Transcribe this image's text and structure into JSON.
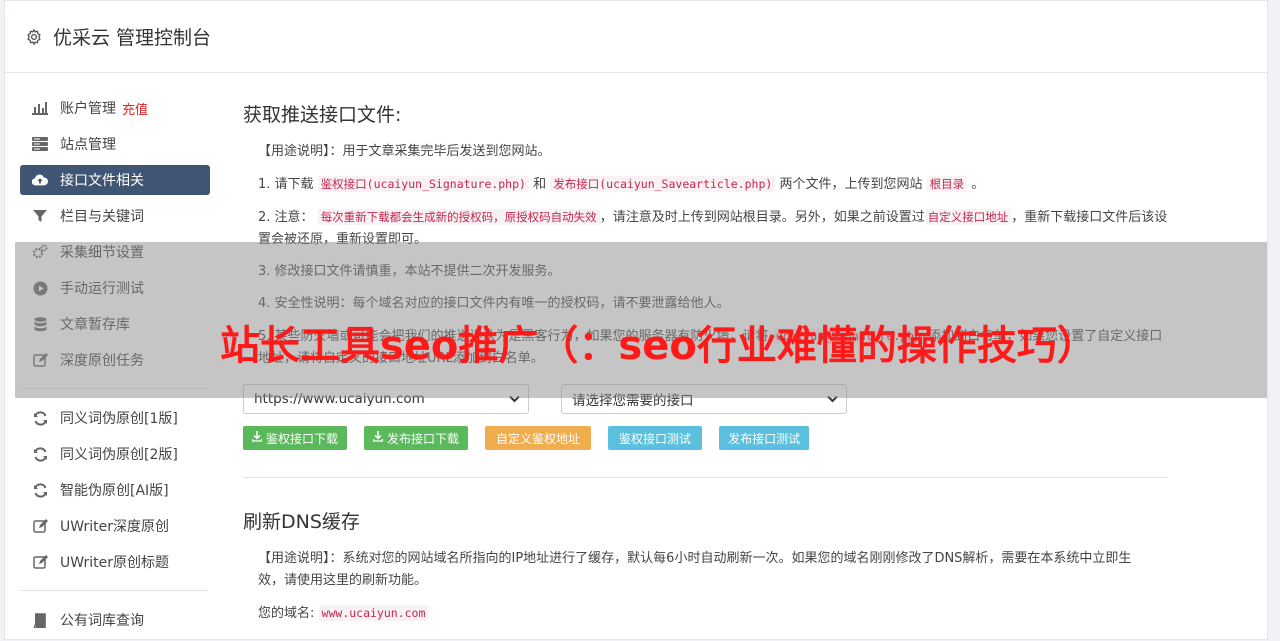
{
  "header": {
    "title": "优采云 管理控制台",
    "icon": "gear-icon"
  },
  "sidebar": {
    "items": [
      {
        "label": "账户管理",
        "extra": "充值",
        "icon": "bar-chart-icon"
      },
      {
        "label": "站点管理",
        "icon": "server-icon"
      },
      {
        "label": "接口文件相关",
        "icon": "cloud-upload-icon",
        "active": true
      },
      {
        "label": "栏目与关键词",
        "icon": "filter-icon"
      },
      {
        "label": "采集细节设置",
        "icon": "gears-icon"
      },
      {
        "label": "手动运行测试",
        "icon": "play-icon"
      },
      {
        "label": "文章暂存库",
        "icon": "database-icon"
      },
      {
        "label": "深度原创任务",
        "icon": "edit-icon"
      }
    ],
    "items2": [
      {
        "label": "同义词伪原创[1版]",
        "icon": "refresh-icon"
      },
      {
        "label": "同义词伪原创[2版]",
        "icon": "refresh-icon"
      },
      {
        "label": "智能伪原创[AI版]",
        "icon": "refresh-icon"
      },
      {
        "label": "UWriter深度原创",
        "icon": "edit-icon"
      },
      {
        "label": "UWriter原创标题",
        "icon": "edit-icon"
      }
    ],
    "items3": [
      {
        "label": "公有词库查询",
        "icon": "book-icon"
      }
    ]
  },
  "main": {
    "section1_title": "获取推送接口文件:",
    "usage": "【用途说明】：用于文章采集完毕后发送到您网站。",
    "step1_prefix": "1. 请下载",
    "step1_code1": "鉴权接口(ucaiyun_Signature.php)",
    "step1_and": "和",
    "step1_code2": "发布接口(ucaiyun_Savearticle.php)",
    "step1_mid": "两个文件，上传到您网站",
    "step1_code3": "根目录",
    "step1_end": "。",
    "step2_prefix": "2. 注意：",
    "step2_code1": "每次重新下载都会生成新的授权码，原授权码自动失效",
    "step2_mid": "，请注意及时上传到网站根目录。另外，如果之前设置过",
    "step2_code2": "自定义接口地址",
    "step2_end": "，重新下载接口文件后该设置会被还原，重新设置即可。",
    "step3": "3. 修改接口文件请慎重，本站不提供二次开发服务。",
    "step4": "4. 安全性说明：每个域名对应的接口文件内有唯一的授权码，请不要泄露给他人。",
    "step5_prefix": "5. 某些防火墙或可能会把我们的推送误认为是黑客行为，如果您的服务器有防火墙，请将",
    "step5_code": "ucaiyun_Signature.php",
    "step5_end": "添加到白名单，如果您设置了自定义接口地址，请将自定义的接口地址URL添加到白名单。",
    "select_domain": "https://www.ucaiyun.com",
    "select_interface": "请选择您需要的接口",
    "buttons": {
      "sign_download": "鉴权接口下载",
      "publish_download": "发布接口下载",
      "custom_sign": "自定义鉴权地址",
      "sign_test": "鉴权接口测试",
      "publish_test": "发布接口测试"
    },
    "section2_title": "刷新DNS缓存",
    "dns_usage": "【用途说明】：系统对您的网站域名所指向的IP地址进行了缓存，默认每6小时自动刷新一次。如果您的域名刚刚修改了DNS解析，需要在本系统中立即生效，请使用这里的刷新功能。",
    "domain_label": "您的域名:",
    "domain_value": "www.ucaiyun.com"
  },
  "overlay": {
    "headline": "站长工具seo推广（：seo行业难懂的操作技巧）"
  }
}
